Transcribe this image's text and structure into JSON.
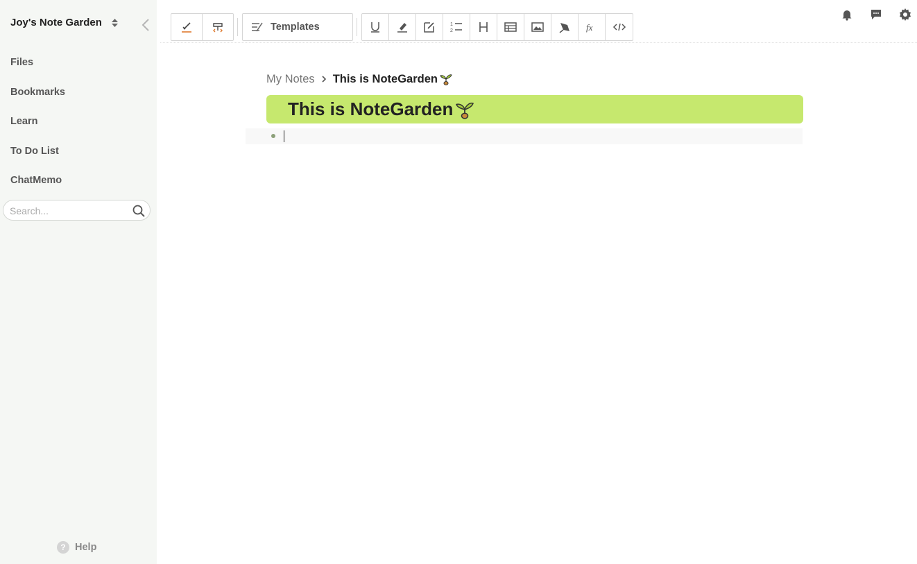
{
  "sidebar": {
    "workspace_name": "Joy's Note Garden",
    "nav_items": [
      {
        "label": "Files"
      },
      {
        "label": "Bookmarks"
      },
      {
        "label": "Learn"
      },
      {
        "label": "To Do List"
      },
      {
        "label": "ChatMemo"
      }
    ],
    "search_placeholder": "Search...",
    "help_label": "Help",
    "help_glyph": "?"
  },
  "toolbar": {
    "groups": [
      {
        "buttons": [
          {
            "icon": "pen-line-icon"
          },
          {
            "icon": "format-painter-icon"
          }
        ]
      },
      {
        "buttons": [
          {
            "icon": "underline-icon"
          },
          {
            "icon": "highlighter-icon"
          },
          {
            "icon": "edit-box-icon"
          },
          {
            "icon": "numbered-list-icon"
          },
          {
            "icon": "heading-icon"
          },
          {
            "icon": "table-icon"
          },
          {
            "icon": "image-icon"
          },
          {
            "icon": "pen-nib-icon"
          },
          {
            "icon": "formula-icon"
          },
          {
            "icon": "code-icon"
          }
        ]
      }
    ],
    "templates_label": "Templates"
  },
  "header_icons": [
    "bell-icon",
    "chat-icon",
    "gear-icon"
  ],
  "breadcrumb": {
    "root": "My Notes",
    "current": "This is NoteGarden"
  },
  "note": {
    "title": "This is NoteGarden",
    "title_bg": "#c6e86e",
    "sprout_icon": "sprout-icon"
  },
  "colors": {
    "sidebar_bg": "#f5f7f4",
    "accent": "#c6e86e"
  }
}
